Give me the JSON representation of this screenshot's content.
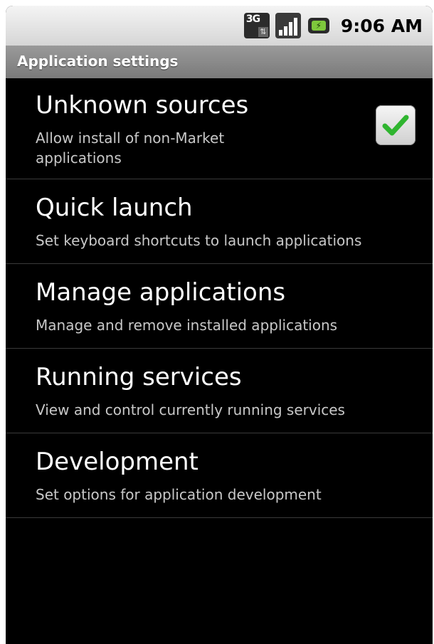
{
  "status_bar": {
    "network_label": "3G",
    "time": "9:06 AM",
    "icons": [
      "3g-data-icon",
      "signal-icon",
      "battery-icon"
    ]
  },
  "title_bar": {
    "title": "Application settings"
  },
  "settings": [
    {
      "title": "Unknown sources",
      "summary": "Allow install of non-Market applications",
      "checked": true
    },
    {
      "title": "Quick launch",
      "summary": "Set keyboard shortcuts to launch applications"
    },
    {
      "title": "Manage applications",
      "summary": "Manage and remove installed applications"
    },
    {
      "title": "Running services",
      "summary": "View and control currently running services"
    },
    {
      "title": "Development",
      "summary": "Set options for application development"
    }
  ],
  "colors": {
    "check_green": "#2fb52f",
    "background": "#000000",
    "title_bar": "#8a8a8a"
  }
}
